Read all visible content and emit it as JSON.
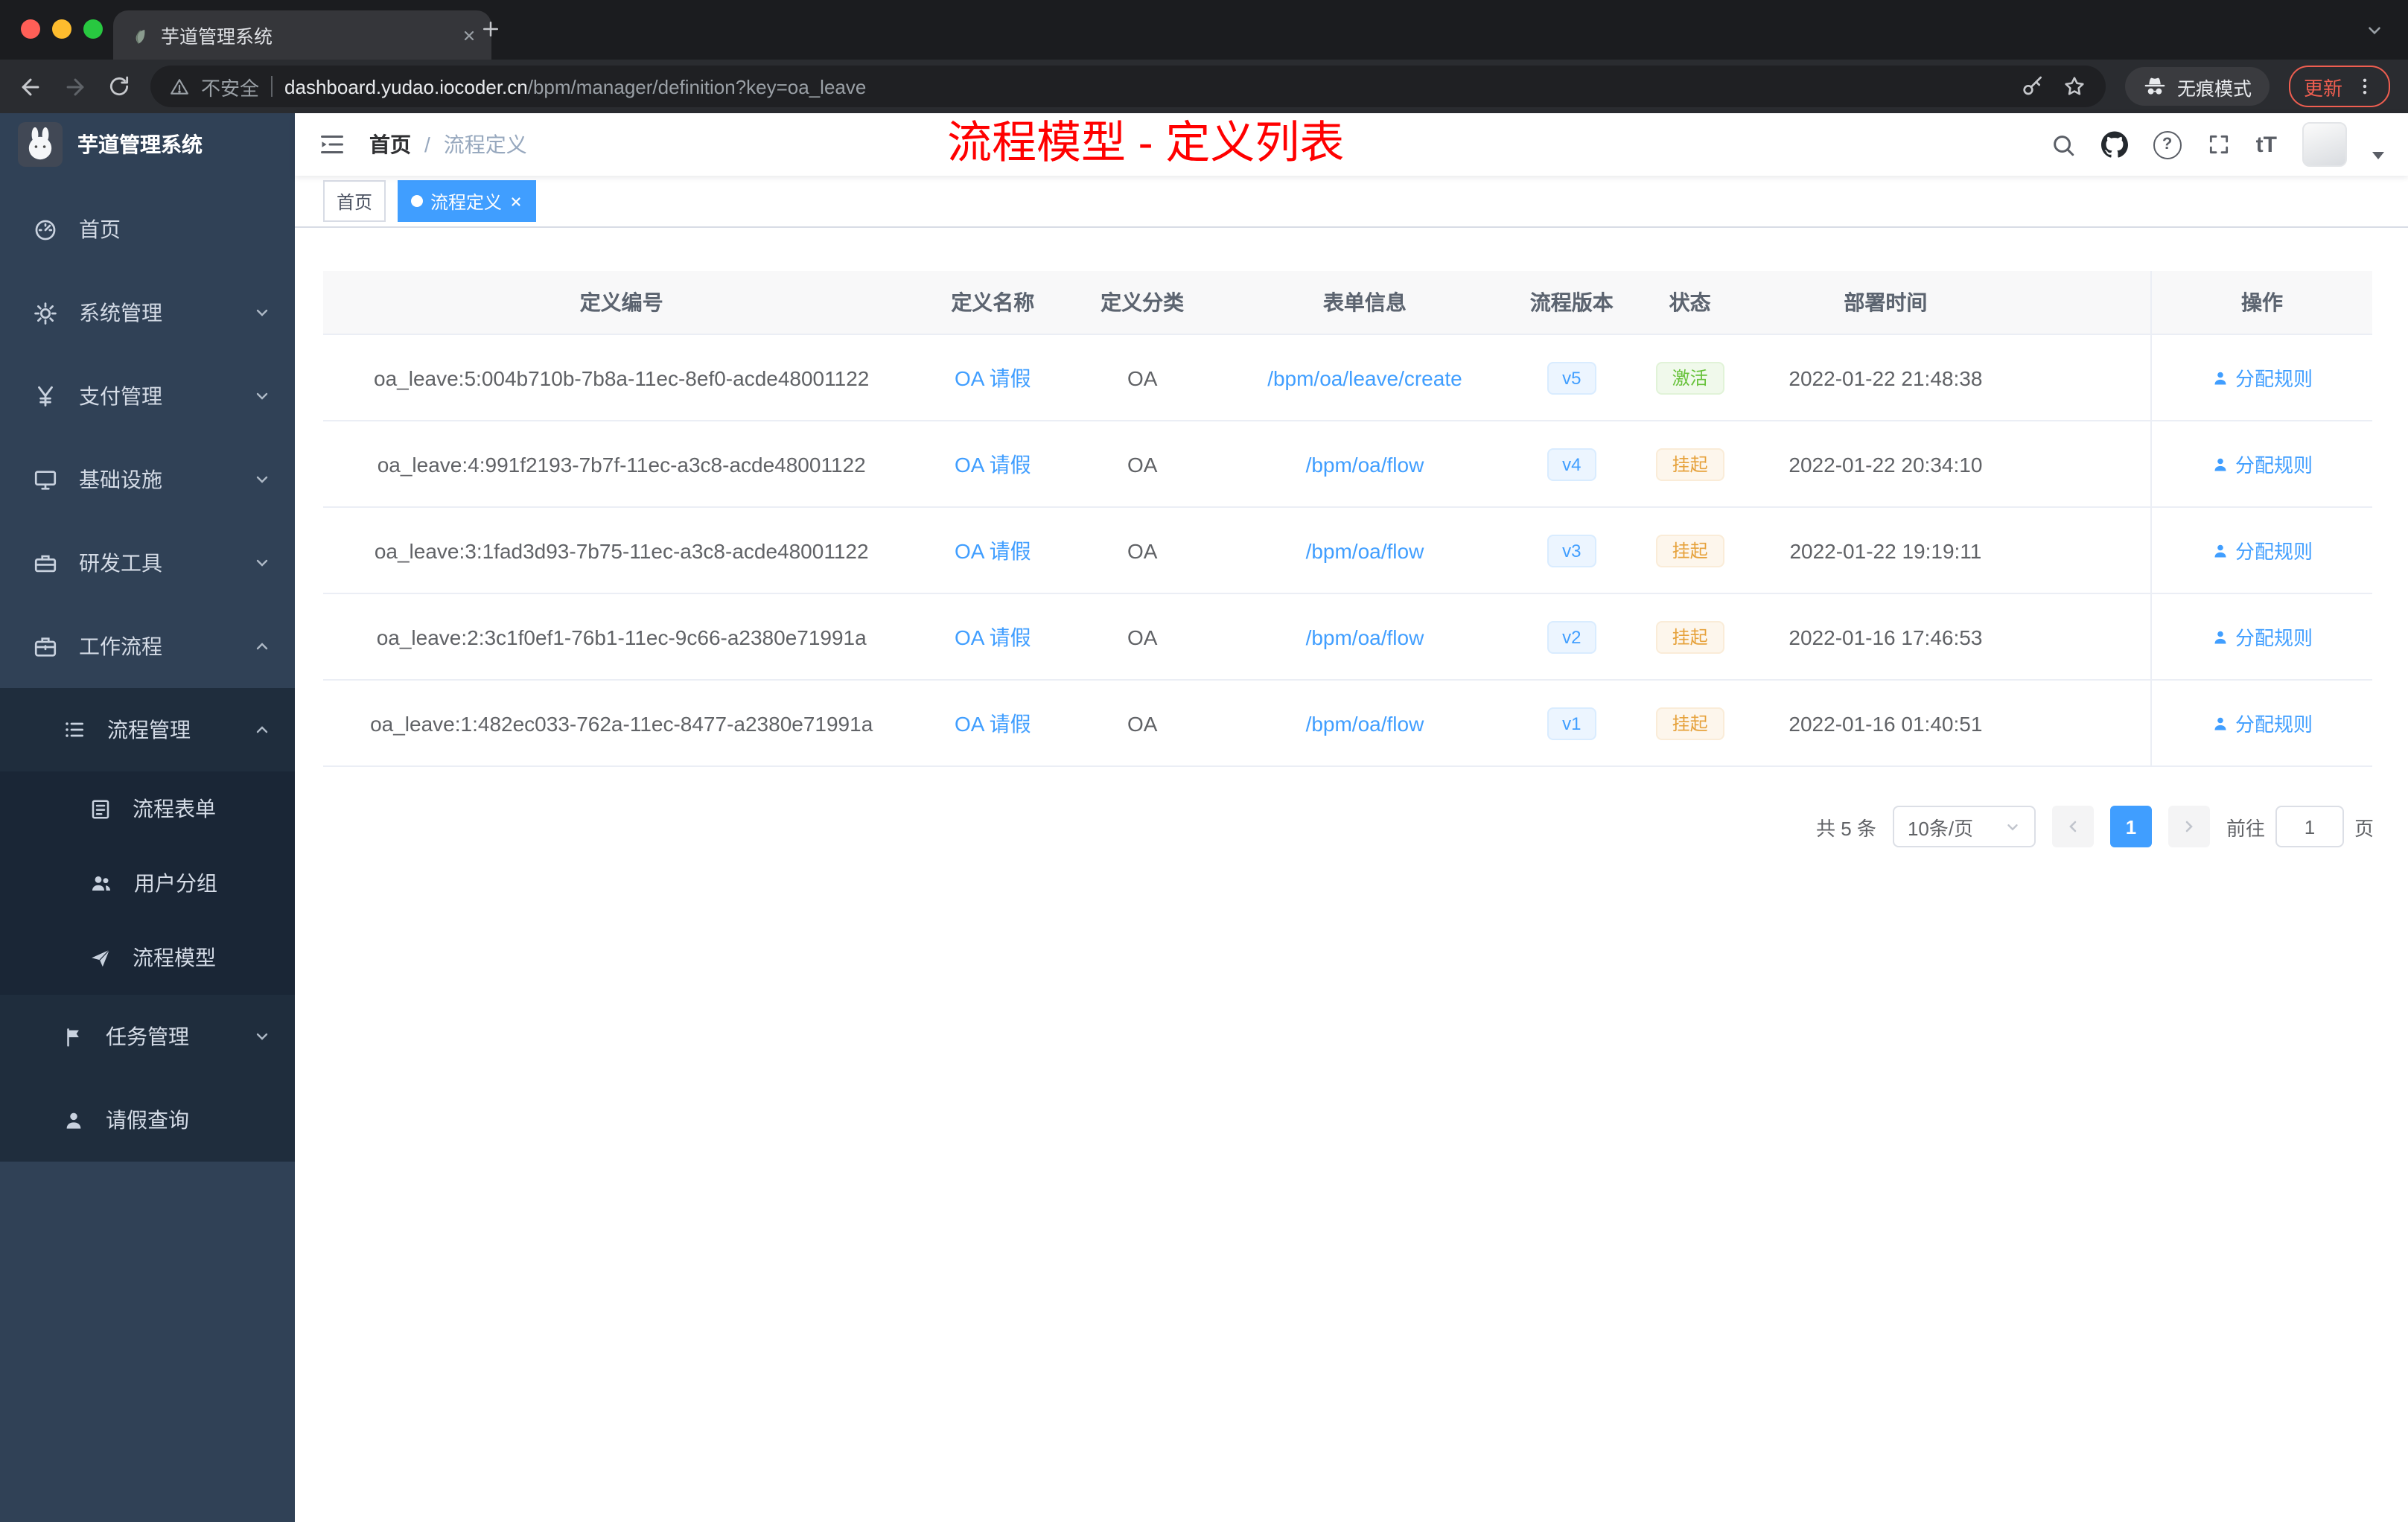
{
  "browser": {
    "tab_title": "芋道管理系统",
    "url_security": "不安全",
    "url_domain": "dashboard.yudao.iocoder.cn",
    "url_path": "/bpm/manager/definition?key=oa_leave",
    "incognito_label": "无痕模式",
    "update_label": "更新"
  },
  "sidebar": {
    "logo_title": "芋道管理系统",
    "items": [
      {
        "label": "首页",
        "icon": "dashboard-icon",
        "level": 1
      },
      {
        "label": "系统管理",
        "icon": "gear-icon",
        "level": 1,
        "expanded": false
      },
      {
        "label": "支付管理",
        "icon": "yen-icon",
        "level": 1,
        "expanded": false
      },
      {
        "label": "基础设施",
        "icon": "monitor-icon",
        "level": 1,
        "expanded": false
      },
      {
        "label": "研发工具",
        "icon": "toolbox-icon",
        "level": 1,
        "expanded": false
      },
      {
        "label": "工作流程",
        "icon": "briefcase-icon",
        "level": 1,
        "expanded": true
      },
      {
        "label": "流程管理",
        "icon": "list-tree-icon",
        "level": 2,
        "expanded": true
      },
      {
        "label": "流程表单",
        "icon": "form-icon",
        "level": 3
      },
      {
        "label": "用户分组",
        "icon": "users-icon",
        "level": 3
      },
      {
        "label": "流程模型",
        "icon": "paper-plane-icon",
        "level": 3
      },
      {
        "label": "任务管理",
        "icon": "flag-icon",
        "level": 2,
        "expanded": false
      },
      {
        "label": "请假查询",
        "icon": "person-icon",
        "level": 2
      }
    ]
  },
  "header": {
    "breadcrumb_home": "首页",
    "breadcrumb_separator": "/",
    "breadcrumb_current": "流程定义",
    "annotation": "流程模型 - 定义列表",
    "help_glyph": "?",
    "font_resize_glyph": "tT"
  },
  "tags": [
    {
      "label": "首页",
      "active": false
    },
    {
      "label": "流程定义",
      "active": true
    }
  ],
  "table": {
    "columns": [
      "定义编号",
      "定义名称",
      "定义分类",
      "表单信息",
      "流程版本",
      "状态",
      "部署时间",
      "操作"
    ],
    "rows": [
      {
        "id": "oa_leave:5:004b710b-7b8a-11ec-8ef0-acde48001122",
        "name": "OA 请假",
        "category": "OA",
        "form": "/bpm/oa/leave/create",
        "version": "v5",
        "status": "激活",
        "status_type": "success",
        "time": "2022-01-22 21:48:38",
        "action": "分配规则"
      },
      {
        "id": "oa_leave:4:991f2193-7b7f-11ec-a3c8-acde48001122",
        "name": "OA 请假",
        "category": "OA",
        "form": "/bpm/oa/flow",
        "version": "v4",
        "status": "挂起",
        "status_type": "warning",
        "time": "2022-01-22 20:34:10",
        "action": "分配规则"
      },
      {
        "id": "oa_leave:3:1fad3d93-7b75-11ec-a3c8-acde48001122",
        "name": "OA 请假",
        "category": "OA",
        "form": "/bpm/oa/flow",
        "version": "v3",
        "status": "挂起",
        "status_type": "warning",
        "time": "2022-01-22 19:19:11",
        "action": "分配规则"
      },
      {
        "id": "oa_leave:2:3c1f0ef1-76b1-11ec-9c66-a2380e71991a",
        "name": "OA 请假",
        "category": "OA",
        "form": "/bpm/oa/flow",
        "version": "v2",
        "status": "挂起",
        "status_type": "warning",
        "time": "2022-01-16 17:46:53",
        "action": "分配规则"
      },
      {
        "id": "oa_leave:1:482ec033-762a-11ec-8477-a2380e71991a",
        "name": "OA 请假",
        "category": "OA",
        "form": "/bpm/oa/flow",
        "version": "v1",
        "status": "挂起",
        "status_type": "warning",
        "time": "2022-01-16 01:40:51",
        "action": "分配规则"
      }
    ]
  },
  "pagination": {
    "total_label": "共 5 条",
    "page_size_label": "10条/页",
    "current_page": "1",
    "goto_label": "前往",
    "goto_value": "1",
    "page_unit": "页"
  },
  "colors": {
    "accent": "#409eff",
    "annotation_red": "#ff0000",
    "success_text": "#67c23a",
    "success_bg": "#f0f9eb",
    "warning_text": "#e6a23c",
    "warning_bg": "#fdf6ec",
    "sidebar_bg": "#304156",
    "submenu_bg": "#1f2d3d",
    "update_red": "#ef5e50"
  }
}
